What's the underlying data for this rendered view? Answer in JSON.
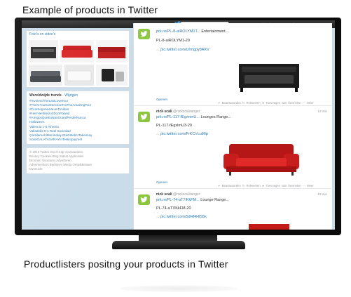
{
  "captions": {
    "top": "Example of products in Twitter",
    "bottom": "Productlisters positng your products in Twitter"
  },
  "topbar": {
    "search_placeholder": "Zoeken",
    "account_text": "Heb je al een account? Inloggen ▾"
  },
  "sidebar": {
    "photos_title": "Foto's en video's",
    "trends_title": "Wereldwijde trends",
    "trends_change": "· Wijzigen",
    "trends": [
      "#InvolvedTheLastLoveTour",
      "#ThereYouGoDirectionForTheAmazingTour",
      "#FinsSegunesiaLasTimidas",
      "#HerrHerBreizo3D1nPoland",
      "#AmigosQueEuNaoGuardPerderNunca",
      "Halloween",
      "Valencia 1-0 Almeria",
      "Valladolid 0-1 Real Sociedad",
      "ÇarsilamAbiMeninatay EtaOstetimTakeimay",
      "SotolGALATASARAYInTeslimpaymet"
    ],
    "footer": [
      "© 2013 Twitter  Over  Hulp  Voorwaarden",
      "Privacy  Cookies  Blog  Status  Applicaties",
      "Bronnen  Vacatures  Adverteren",
      "Adverteerders  Bedrijven  Media  Ontwikkelaars",
      "Overzicht"
    ]
  },
  "tweets": [
    {
      "name": "",
      "handle": "",
      "time": "",
      "link": "prk.re/PL-8-aiROLYM1T...",
      "link_rest": " Entertainment...",
      "code": "PL-8-aiROLYM1-20",
      "url_pre": "... ",
      "url": "pic.twitter.com/Urmgpy8AKV",
      "open": "Openen",
      "actions": "↩ Beantwoorden  ↻ Retweeten  ★ Toevoegen aan favorieten  ··· Meer",
      "image": "tv-cabinet"
    },
    {
      "name": "nick scali",
      "handle": "@nickscaliranger",
      "time": "13 min",
      "link": "prk.re/PL-117-fEgxnmU...",
      "link_rest": " Lounges Range...",
      "code": "PL-117-fEgxlmU3-20",
      "url_pre": "... ",
      "url": "pic.twitter.com/FrKCVcu86p",
      "open": "Openen",
      "actions": "↩ Beantwoorden  ↻ Retweeten  ★ Toevoegen aan favorieten  ··· Meer",
      "image": "red-sofa"
    },
    {
      "name": "nick scali",
      "handle": "@nickscaliranger",
      "time": "13 min",
      "link": "prk.re/PL-74-aT7lKkFM...",
      "link_rest": " Lounge Range...",
      "code": "PL-74-aT7lKkFM-20",
      "url_pre": "... ",
      "url": "pic.twitter.com/5dHf4HlS5k",
      "open": "",
      "actions": "",
      "image": "red-top"
    }
  ]
}
